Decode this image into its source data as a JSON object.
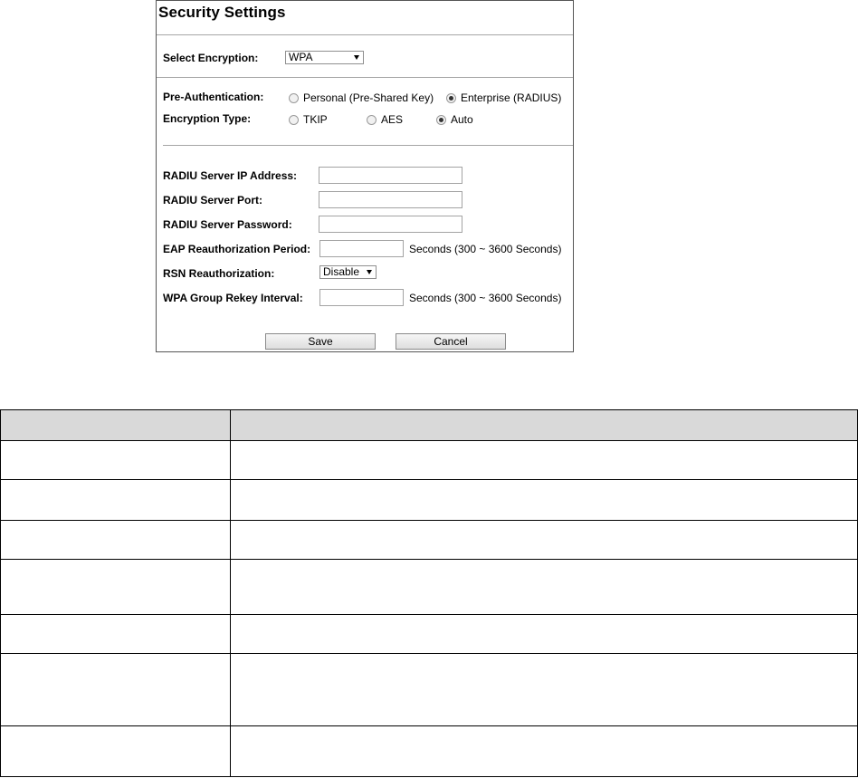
{
  "panel": {
    "title": "Security Settings",
    "select_encryption": {
      "label": "Select Encryption:",
      "value": "WPA"
    },
    "pre_authentication": {
      "label": "Pre-Authentication:",
      "options": [
        {
          "label": "Personal (Pre-Shared Key)",
          "checked": false
        },
        {
          "label": "Enterprise (RADIUS)",
          "checked": true
        }
      ]
    },
    "encryption_type": {
      "label": "Encryption Type:",
      "options": [
        {
          "label": "TKIP",
          "checked": false
        },
        {
          "label": "AES",
          "checked": false
        },
        {
          "label": "Auto",
          "checked": true
        }
      ]
    },
    "radius_ip": {
      "label": "RADIU Server IP Address:",
      "value": ""
    },
    "radius_port": {
      "label": "RADIU Server Port:",
      "value": ""
    },
    "radius_password": {
      "label": "RADIU Server Password:",
      "value": ""
    },
    "eap_period": {
      "label": "EAP Reauthorization Period:",
      "value": "",
      "hint": "Seconds  (300 ~ 3600 Seconds)"
    },
    "rsn_reauth": {
      "label": "RSN Reauthorization:",
      "value": "Disable"
    },
    "wpa_rekey": {
      "label": "WPA Group Rekey Interval:",
      "value": "",
      "hint": "Seconds  (300 ~ 3600 Seconds)"
    },
    "buttons": {
      "save": "Save",
      "cancel": "Cancel"
    }
  },
  "table": {
    "headers": [
      "",
      ""
    ],
    "rows": [
      [
        "",
        ""
      ],
      [
        "",
        ""
      ],
      [
        "",
        ""
      ],
      [
        "",
        ""
      ],
      [
        "",
        ""
      ],
      [
        "",
        ""
      ],
      [
        "",
        ""
      ]
    ]
  }
}
